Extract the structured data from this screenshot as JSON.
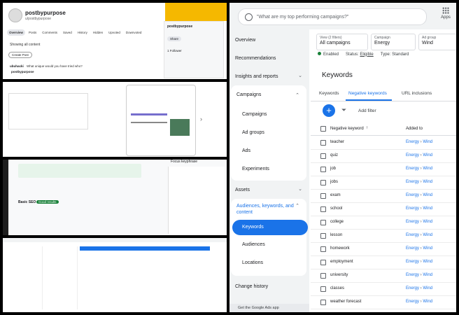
{
  "reddit": {
    "username": "postbypurpose",
    "handle": "u/postbypurpose",
    "tabs": [
      "Overview",
      "Posts",
      "Comments",
      "Saved",
      "History",
      "Hidden",
      "Upvoted",
      "Downvoted"
    ],
    "create_post": "Create Post",
    "showing": "Showing all content",
    "comment_user": "ubuhacki",
    "comment_text": "What unique would you have tried who?",
    "comment_by": "postbypurpose",
    "card_name": "postbypurpose",
    "card_button": "Share",
    "card_stat1": "1 Follower"
  },
  "ads": {
    "search_placeholder": "\"What are my top performing campaigns?\"",
    "apps_label": "Apps",
    "sidebar": {
      "overview": "Overview",
      "recommendations": "Recommendations",
      "insights": "Insights and reports",
      "campaigns": "Campaigns",
      "campaigns_sub": "Campaigns",
      "ad_groups": "Ad groups",
      "ads": "Ads",
      "experiments": "Experiments",
      "assets": "Assets",
      "audiences_group": "Audiences, keywords, and content",
      "keywords": "Keywords",
      "audiences": "Audiences",
      "locations": "Locations",
      "change_history": "Change history",
      "footer": "Get the Google Ads app"
    },
    "filters": [
      {
        "label": "View (2 filters)",
        "value": "All campaigns"
      },
      {
        "label": "Campaign",
        "value": "Energy"
      },
      {
        "label": "Ad group",
        "value": "Wind"
      }
    ],
    "status": {
      "enabled": "Enabled",
      "status_label": "Status:",
      "status_value": "Eligible",
      "type_label": "Type:",
      "type_value": "Standard"
    },
    "title": "Keywords",
    "tabs": [
      "Keywords",
      "Negative keywords",
      "URL inclusions"
    ],
    "add_filter": "Add filter",
    "col_keyword": "Negative keyword",
    "col_added": "Added to",
    "rows": [
      {
        "keyword": "teacher",
        "level": "Energy",
        "group": "Wind"
      },
      {
        "keyword": "quiz",
        "level": "Energy",
        "group": "Wind"
      },
      {
        "keyword": "job",
        "level": "Energy",
        "group": "Wind"
      },
      {
        "keyword": "jobs",
        "level": "Energy",
        "group": "Wind"
      },
      {
        "keyword": "exam",
        "level": "Energy",
        "group": "Wind"
      },
      {
        "keyword": "school",
        "level": "Energy",
        "group": "Wind"
      },
      {
        "keyword": "college",
        "level": "Energy",
        "group": "Wind"
      },
      {
        "keyword": "lesson",
        "level": "Energy",
        "group": "Wind"
      },
      {
        "keyword": "homework",
        "level": "Energy",
        "group": "Wind"
      },
      {
        "keyword": "employment",
        "level": "Energy",
        "group": "Wind"
      },
      {
        "keyword": "university",
        "level": "Energy",
        "group": "Wind"
      },
      {
        "keyword": "classes",
        "level": "Energy",
        "group": "Wind"
      },
      {
        "keyword": "weather forecast",
        "level": "Energy",
        "group": "Wind"
      }
    ]
  },
  "seo": {
    "section": "Focus keyphrase",
    "analysis": "Basic SEO",
    "status": "Good results"
  },
  "colors": {
    "accent": "#1a73e8",
    "enabled": "#188038",
    "brand_yellow": "#f5b800"
  }
}
